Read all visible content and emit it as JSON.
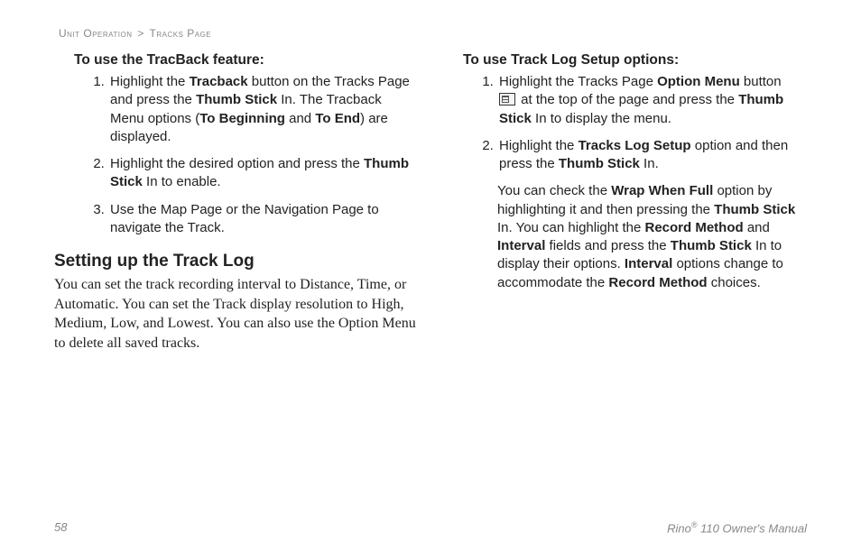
{
  "breadcrumb": {
    "a": "Unit Operation",
    "sep": ">",
    "b": "Tracks Page"
  },
  "left": {
    "proc_title": "To use the TracBack feature:",
    "steps": {
      "s1_a": "Highlight the ",
      "s1_b": "Tracback",
      "s1_c": " button on the Tracks Page and press the ",
      "s1_d": "Thumb Stick",
      "s1_e": " In. The Tracback Menu options (",
      "s1_f": "To Beginning",
      "s1_g": " and ",
      "s1_h": "To End",
      "s1_i": ") are displayed.",
      "s2_a": "Highlight the desired option and press the ",
      "s2_b": "Thumb Stick",
      "s2_c": " In to enable.",
      "s3": "Use the Map Page or the Navigation Page to navigate the Track."
    },
    "section_title": "Setting up the Track Log",
    "section_para": "You can set the track recording interval to Distance, Time, or Automatic. You can set the Track display resolution to High, Medium, Low, and Lowest. You can also use the Option Menu to delete all saved tracks."
  },
  "right": {
    "proc_title": "To use Track Log Setup options:",
    "steps": {
      "s1_a": "Highlight the Tracks Page ",
      "s1_b": "Option Menu",
      "s1_c": " button ",
      "s1_d": " at the top of the page and press the ",
      "s1_e": "Thumb Stick",
      "s1_f": " In to display the menu.",
      "s2_a": "Highlight the ",
      "s2_b": "Tracks Log Setup",
      "s2_c": " option and then press the ",
      "s2_d": "Thumb Stick",
      "s2_e": " In."
    },
    "note": {
      "a": "You can check the ",
      "b": "Wrap When Full",
      "c": " option by highlighting it and then pressing the ",
      "d": "Thumb Stick",
      "e": " In. You can highlight the ",
      "f": "Record Method",
      "g": " and ",
      "h": "Interval",
      "i": " fields and press the ",
      "j": "Thumb Stick",
      "k": " In to display their options. ",
      "l": "Interval",
      "m": " options change to accommodate the ",
      "n": "Record Method",
      "o": " choices."
    }
  },
  "footer": {
    "page": "58",
    "brand_a": "Rino",
    "brand_sup": "®",
    "brand_b": " 110 Owner's Manual"
  }
}
